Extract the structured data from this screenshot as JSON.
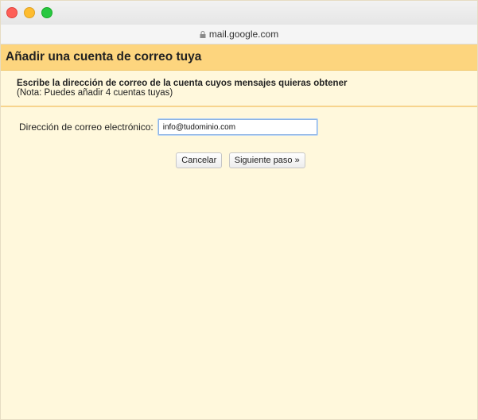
{
  "browser": {
    "url": "mail.google.com"
  },
  "dialog": {
    "title": "Añadir una cuenta de correo tuya",
    "instruction": "Escribe la dirección de correo de la cuenta cuyos mensajes quieras obtener",
    "note": "(Nota: Puedes añadir 4 cuentas tuyas)",
    "email_label": "Dirección de correo electrónico:",
    "email_value": "info@tudominio.com",
    "cancel_label": "Cancelar",
    "next_label": "Siguiente paso »"
  },
  "colors": {
    "header_bg": "#fdd57e",
    "page_bg": "#fff8dc",
    "close": "#fe5f57",
    "minimize": "#febc2e",
    "maximize": "#28c840"
  }
}
